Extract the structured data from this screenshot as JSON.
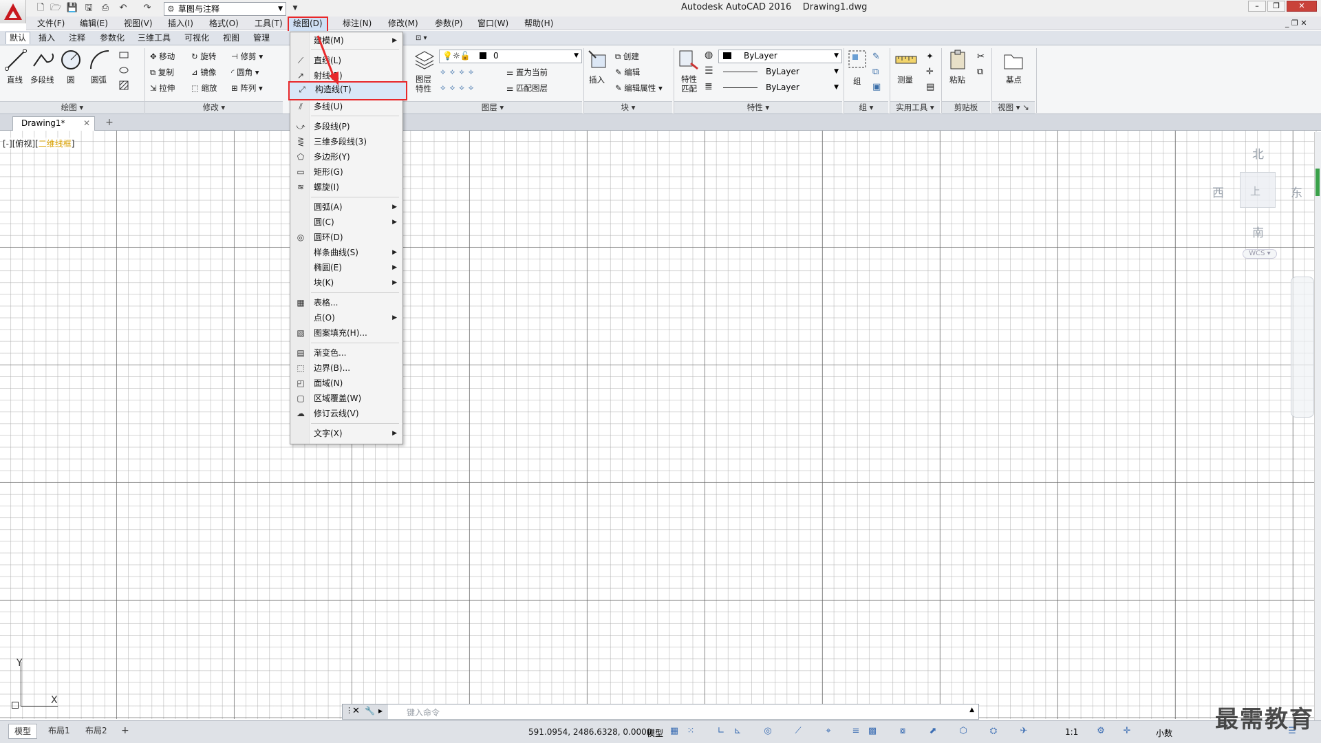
{
  "title": {
    "app": "Autodesk AutoCAD 2016",
    "file": "Drawing1.dwg",
    "workspace": "草图与注释"
  },
  "menubar": [
    "文件(F)",
    "编辑(E)",
    "视图(V)",
    "插入(I)",
    "格式(O)",
    "工具(T)",
    "绘图(D)",
    "标注(N)",
    "修改(M)",
    "参数(P)",
    "窗口(W)",
    "帮助(H)"
  ],
  "ribbon_tabs": [
    "默认",
    "插入",
    "注释",
    "参数化",
    "三维工具",
    "可视化",
    "视图",
    "管理"
  ],
  "ribbon": {
    "draw": {
      "title": "绘图",
      "line": "直线",
      "polyline": "多段线",
      "circle": "圆",
      "arc": "圆弧"
    },
    "modify": {
      "title": "修改",
      "move": "移动",
      "rotate": "旋转",
      "trim": "修剪",
      "copy": "复制",
      "mirror": "镜像",
      "fillet": "圆角",
      "stretch": "拉伸",
      "scale": "缩放",
      "array": "阵列"
    },
    "layers": {
      "title": "图层",
      "props": "图层\n特性",
      "current_layer": "0",
      "make_current": "置为当前",
      "match_layer": "匹配图层",
      "props_line1": "图层",
      "props_line2": "特性"
    },
    "block": {
      "title": "块",
      "insert": "插入",
      "create": "创建",
      "edit": "编辑",
      "edit_attr": "编辑属性"
    },
    "properties": {
      "title": "特性",
      "match": "特性\n匹配",
      "match_line1": "特性",
      "match_line2": "匹配",
      "color": "ByLayer",
      "linetype": "ByLayer",
      "lineweight": "ByLayer"
    },
    "groups": {
      "title": "组",
      "group": "组"
    },
    "utilities": {
      "title": "实用工具",
      "measure": "测量"
    },
    "clipboard": {
      "title": "剪贴板",
      "paste": "粘贴"
    },
    "view": {
      "title": "视图",
      "base": "基点"
    }
  },
  "doc_tab": {
    "name": "Drawing1*"
  },
  "viewport_label": {
    "prefix": "[-][俯视][",
    "style": "二维线框",
    "suffix": "]"
  },
  "viewcube": {
    "north": "北",
    "south": "南",
    "east": "东",
    "west": "西",
    "face": "上",
    "wcs": "WCS"
  },
  "ucs": {
    "x": "X",
    "y": "Y"
  },
  "draw_menu": [
    {
      "label": "建模(M)",
      "sub": true
    },
    {
      "label": "直线(L)"
    },
    {
      "label": "射线(R)"
    },
    {
      "label": "构造线(T)",
      "highlight": true
    },
    {
      "label": "多线(U)"
    },
    {
      "label": "多段线(P)"
    },
    {
      "label": "三维多段线(3)"
    },
    {
      "label": "多边形(Y)"
    },
    {
      "label": "矩形(G)"
    },
    {
      "label": "螺旋(I)"
    },
    {
      "label": "圆弧(A)",
      "sub": true
    },
    {
      "label": "圆(C)",
      "sub": true
    },
    {
      "label": "圆环(D)"
    },
    {
      "label": "样条曲线(S)",
      "sub": true
    },
    {
      "label": "椭圆(E)",
      "sub": true
    },
    {
      "label": "块(K)",
      "sub": true
    },
    {
      "label": "表格..."
    },
    {
      "label": "点(O)",
      "sub": true
    },
    {
      "label": "图案填充(H)..."
    },
    {
      "label": "渐变色..."
    },
    {
      "label": "边界(B)..."
    },
    {
      "label": "面域(N)"
    },
    {
      "label": "区域覆盖(W)"
    },
    {
      "label": "修订云线(V)"
    },
    {
      "label": "文字(X)",
      "sub": true
    }
  ],
  "command_line": {
    "placeholder": "键入命令"
  },
  "status": {
    "layout_tabs": [
      "模型",
      "布局1",
      "布局2"
    ],
    "coords": "591.0954, 2486.6328, 0.0000",
    "model": "模型",
    "scale": "1:1",
    "units": "小数"
  },
  "watermark": "最需教育"
}
